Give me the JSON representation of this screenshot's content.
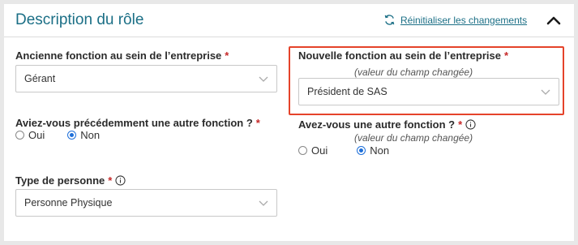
{
  "section": {
    "title": "Description du rôle",
    "reset_label": "Réinitialiser les changements"
  },
  "icons": {
    "reset": "refresh-icon",
    "collapse": "chevron-up-icon",
    "select_arrow": "chevron-down-icon",
    "info": "info-icon"
  },
  "colors": {
    "accent": "#1b6f86",
    "required": "#c62828",
    "highlight_border": "#e5432a",
    "radio_selected": "#1e6fd9"
  },
  "fields": {
    "old_function": {
      "label": "Ancienne fonction au sein de l’entreprise",
      "required": "*",
      "value": "Gérant"
    },
    "new_function": {
      "label": "Nouvelle fonction au sein de l’entreprise",
      "required": "*",
      "note": "(valeur du champ changée)",
      "value": "Président de SAS"
    },
    "had_other_function": {
      "label": "Aviez-vous précédemment une autre fonction ?",
      "required": "*",
      "options": [
        "Oui",
        "Non"
      ],
      "selected": "Non"
    },
    "has_other_function": {
      "label": "Avez-vous une autre fonction ?",
      "required": "*",
      "note": "(valeur du champ changée)",
      "options": [
        "Oui",
        "Non"
      ],
      "selected": "Non"
    },
    "person_type": {
      "label": "Type de personne",
      "required": "*",
      "value": "Personne Physique"
    }
  }
}
